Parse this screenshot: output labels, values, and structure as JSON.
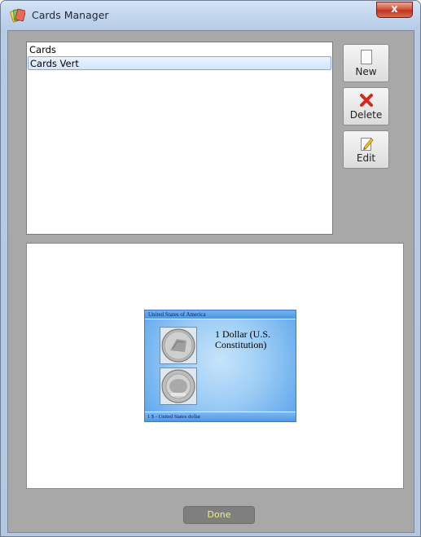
{
  "window": {
    "title": "Cards Manager",
    "close_label": "x"
  },
  "list": {
    "items": [
      {
        "label": "Cards",
        "selected": false
      },
      {
        "label": "Cards Vert",
        "selected": true
      }
    ]
  },
  "buttons": {
    "new_label": "New",
    "delete_label": "Delete",
    "edit_label": "Edit",
    "done_label": "Done"
  },
  "preview": {
    "card": {
      "header": "United States of America",
      "name": "1 Dollar (U.S. Constitution)",
      "footer": "1 $ - United States dollar"
    }
  },
  "icons": {
    "title": "cards-app-icon",
    "new": "blank-page-icon",
    "delete": "red-x-icon",
    "edit": "edit-pencil-icon"
  },
  "colors": {
    "done_text": "#e9f08a",
    "card_blue": "#5aa3eb",
    "client_gray": "#a8a8a8"
  }
}
